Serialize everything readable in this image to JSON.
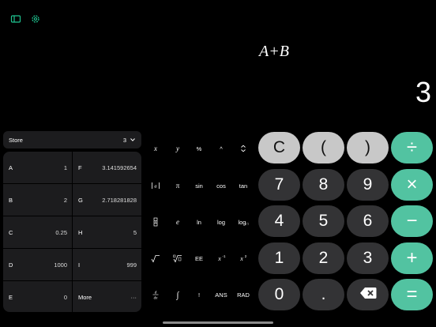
{
  "toolbar": {
    "sidebar_icon": "sidebar-icon",
    "settings_icon": "gear-icon",
    "accent": "#1fc28f"
  },
  "display": {
    "expression": "A+B",
    "result": "3"
  },
  "store": {
    "label": "Store",
    "value": "3"
  },
  "variables": [
    {
      "name": "A",
      "value": "1"
    },
    {
      "name": "F",
      "value": "3.141592654"
    },
    {
      "name": "B",
      "value": "2"
    },
    {
      "name": "G",
      "value": "2.718281828"
    },
    {
      "name": "C",
      "value": "0.25"
    },
    {
      "name": "H",
      "value": "5"
    },
    {
      "name": "D",
      "value": "1000"
    },
    {
      "name": "I",
      "value": "999"
    },
    {
      "name": "E",
      "value": "0"
    },
    {
      "name": "More",
      "value": "···"
    }
  ],
  "functions": {
    "x": "x",
    "y": "y",
    "percent": "%",
    "caret": "^",
    "pi": "π",
    "sin": "sin",
    "cos": "cos",
    "tan": "tan",
    "e": "e",
    "ln": "ln",
    "log": "log",
    "logb": "log",
    "ee": "EE",
    "bang": "!",
    "ans": "ANS",
    "rad": "RAD"
  },
  "keypad": {
    "clear": "C",
    "lparen": "(",
    "rparen": ")",
    "divide": "÷",
    "seven": "7",
    "eight": "8",
    "nine": "9",
    "multiply": "×",
    "four": "4",
    "five": "5",
    "six": "6",
    "minus": "−",
    "one": "1",
    "two": "2",
    "three": "3",
    "plus": "+",
    "zero": "0",
    "dot": ".",
    "equals": "="
  },
  "colors": {
    "operator": "#52c3a1",
    "gray_key": "#c8c8c8",
    "dark_key": "#333335",
    "panel": "#1c1c1e"
  }
}
